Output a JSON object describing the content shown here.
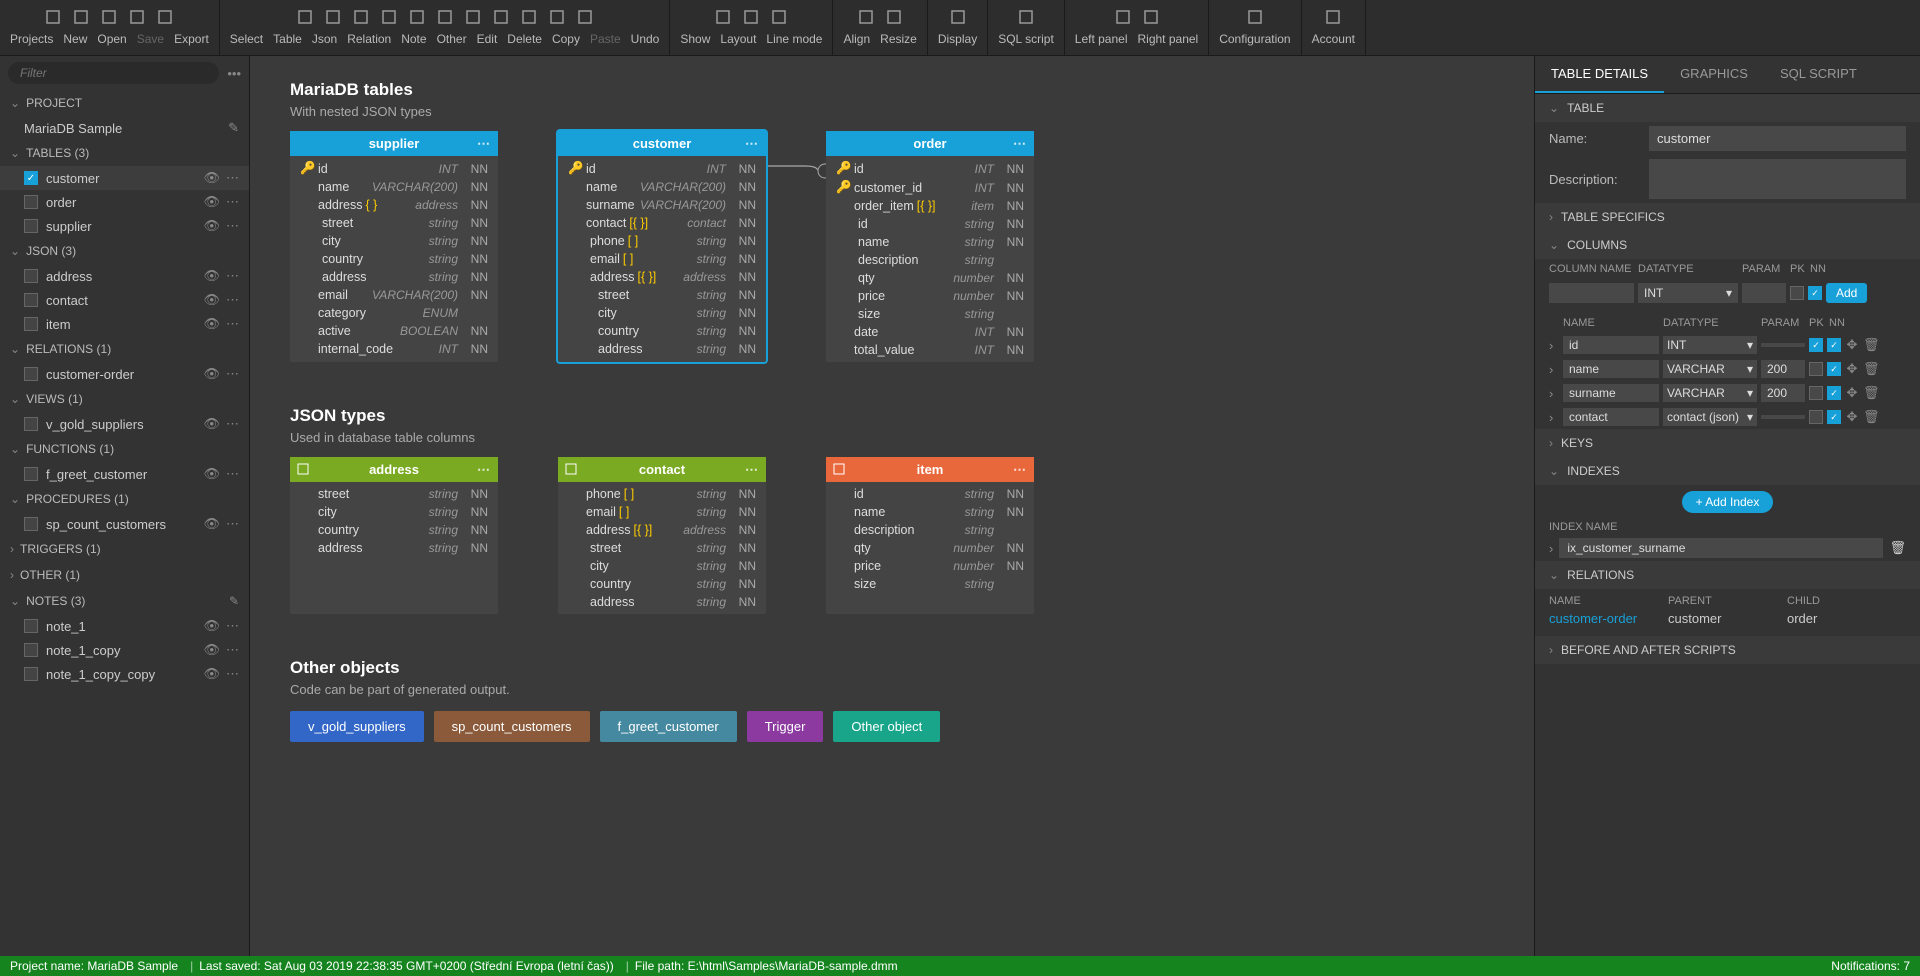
{
  "toolbar": {
    "groups": [
      {
        "labels": [
          "Projects",
          "New",
          "Open",
          "Save",
          "Export"
        ],
        "icons": [
          "folder-multiple",
          "file-new",
          "folder-open",
          "save",
          "export"
        ],
        "disabled": [
          3
        ]
      },
      {
        "labels": [
          "Select",
          "Table",
          "Json",
          "Relation",
          "Note",
          "Other",
          "Edit",
          "Delete",
          "Copy",
          "Paste",
          "Undo"
        ],
        "icons": [
          "cursor",
          "table",
          "json",
          "relation",
          "note",
          "other",
          "edit",
          "delete",
          "copy",
          "paste",
          "undo"
        ],
        "disabled": [
          9
        ]
      },
      {
        "labels": [
          "Show",
          "Layout",
          "Line mode"
        ],
        "icons": [
          "eye",
          "grid",
          "line"
        ]
      },
      {
        "labels": [
          "Align",
          "Resize"
        ],
        "icons": [
          "align",
          "resize"
        ]
      },
      {
        "labels": [
          "Display"
        ],
        "icons": [
          "display"
        ]
      },
      {
        "labels": [
          "SQL script"
        ],
        "icons": [
          "script"
        ]
      },
      {
        "labels": [
          "Left panel",
          "Right panel"
        ],
        "icons": [
          "left-panel",
          "right-panel"
        ],
        "bluedot": [
          0,
          1
        ]
      },
      {
        "labels": [
          "Configuration"
        ],
        "icons": [
          "gear"
        ]
      },
      {
        "labels": [
          "Account"
        ],
        "icons": [
          "user"
        ]
      }
    ]
  },
  "sidebar": {
    "filter_placeholder": "Filter",
    "sections": [
      {
        "title": "PROJECT",
        "items": [
          {
            "label": "MariaDB Sample",
            "edit": true
          }
        ]
      },
      {
        "title": "TABLES (3)",
        "items": [
          {
            "label": "customer",
            "checked": true,
            "active": true
          },
          {
            "label": "order"
          },
          {
            "label": "supplier"
          }
        ]
      },
      {
        "title": "JSON (3)",
        "items": [
          {
            "label": "address"
          },
          {
            "label": "contact"
          },
          {
            "label": "item"
          }
        ]
      },
      {
        "title": "RELATIONS (1)",
        "items": [
          {
            "label": "customer-order"
          }
        ]
      },
      {
        "title": "VIEWS (1)",
        "items": [
          {
            "label": "v_gold_suppliers"
          }
        ]
      },
      {
        "title": "FUNCTIONS (1)",
        "items": [
          {
            "label": "f_greet_customer"
          }
        ]
      },
      {
        "title": "PROCEDURES (1)",
        "items": [
          {
            "label": "sp_count_customers"
          }
        ]
      },
      {
        "title": "TRIGGERS (1)",
        "collapsed": true
      },
      {
        "title": "OTHER (1)",
        "collapsed": true
      },
      {
        "title": "NOTES (3)",
        "items": [
          {
            "label": "note_1"
          },
          {
            "label": "note_1_copy"
          },
          {
            "label": "note_1_copy_copy"
          }
        ]
      }
    ]
  },
  "canvas": {
    "section1": {
      "title": "MariaDB tables",
      "subtitle": "With nested JSON types"
    },
    "tables": {
      "supplier": {
        "name": "supplier",
        "rows": [
          {
            "pk": true,
            "name": "id",
            "type": "INT",
            "nn": "NN"
          },
          {
            "name": "name",
            "type": "VARCHAR(200)",
            "nn": "NN"
          },
          {
            "name": "address",
            "json": "{ }",
            "type": "address",
            "nn": "NN"
          },
          {
            "nested": 1,
            "name": "street",
            "type": "string",
            "nn": "NN"
          },
          {
            "nested": 1,
            "name": "city",
            "type": "string",
            "nn": "NN"
          },
          {
            "nested": 1,
            "name": "country",
            "type": "string",
            "nn": "NN"
          },
          {
            "nested": 1,
            "name": "address",
            "type": "string",
            "nn": "NN"
          },
          {
            "name": "email",
            "type": "VARCHAR(200)",
            "nn": "NN"
          },
          {
            "name": "category",
            "type": "ENUM",
            "nn": ""
          },
          {
            "name": "active",
            "type": "BOOLEAN",
            "nn": "NN"
          },
          {
            "name": "internal_code",
            "type": "INT",
            "nn": "NN"
          }
        ]
      },
      "customer": {
        "name": "customer",
        "rows": [
          {
            "pk": true,
            "name": "id",
            "type": "INT",
            "nn": "NN"
          },
          {
            "name": "name",
            "type": "VARCHAR(200)",
            "nn": "NN"
          },
          {
            "name": "surname",
            "type": "VARCHAR(200)",
            "nn": "NN"
          },
          {
            "name": "contact",
            "json": "[{ }]",
            "type": "contact",
            "nn": "NN"
          },
          {
            "nested": 1,
            "name": "phone",
            "json": "[ ]",
            "type": "string",
            "nn": "NN"
          },
          {
            "nested": 1,
            "name": "email",
            "json": "[ ]",
            "type": "string",
            "nn": "NN"
          },
          {
            "nested": 1,
            "name": "address",
            "json": "[{ }]",
            "type": "address",
            "nn": "NN"
          },
          {
            "nested": 2,
            "name": "street",
            "type": "string",
            "nn": "NN"
          },
          {
            "nested": 2,
            "name": "city",
            "type": "string",
            "nn": "NN"
          },
          {
            "nested": 2,
            "name": "country",
            "type": "string",
            "nn": "NN"
          },
          {
            "nested": 2,
            "name": "address",
            "type": "string",
            "nn": "NN"
          }
        ]
      },
      "order": {
        "name": "order",
        "rows": [
          {
            "pk": true,
            "name": "id",
            "type": "INT",
            "nn": "NN"
          },
          {
            "fk": true,
            "name": "customer_id",
            "type": "INT",
            "nn": "NN"
          },
          {
            "name": "order_item",
            "json": "[{ }]",
            "type": "item",
            "nn": "NN"
          },
          {
            "nested": 1,
            "name": "id",
            "type": "string",
            "nn": "NN"
          },
          {
            "nested": 1,
            "name": "name",
            "type": "string",
            "nn": "NN"
          },
          {
            "nested": 1,
            "name": "description",
            "type": "string",
            "nn": ""
          },
          {
            "nested": 1,
            "name": "qty",
            "type": "number",
            "nn": "NN"
          },
          {
            "nested": 1,
            "name": "price",
            "type": "number",
            "nn": "NN"
          },
          {
            "nested": 1,
            "name": "size",
            "type": "string",
            "nn": ""
          },
          {
            "name": "date",
            "type": "INT",
            "nn": "NN"
          },
          {
            "name": "total_value",
            "type": "INT",
            "nn": "NN"
          }
        ]
      }
    },
    "section2": {
      "title": "JSON types",
      "subtitle": "Used in database table columns"
    },
    "json": {
      "address": {
        "name": "address",
        "rows": [
          {
            "name": "street",
            "type": "string",
            "nn": "NN"
          },
          {
            "name": "city",
            "type": "string",
            "nn": "NN"
          },
          {
            "name": "country",
            "type": "string",
            "nn": "NN"
          },
          {
            "name": "address",
            "type": "string",
            "nn": "NN"
          }
        ]
      },
      "contact": {
        "name": "contact",
        "rows": [
          {
            "name": "phone",
            "json": "[ ]",
            "type": "string",
            "nn": "NN"
          },
          {
            "name": "email",
            "json": "[ ]",
            "type": "string",
            "nn": "NN"
          },
          {
            "name": "address",
            "json": "[{ }]",
            "type": "address",
            "nn": "NN"
          },
          {
            "nested": 1,
            "name": "street",
            "type": "string",
            "nn": "NN"
          },
          {
            "nested": 1,
            "name": "city",
            "type": "string",
            "nn": "NN"
          },
          {
            "nested": 1,
            "name": "country",
            "type": "string",
            "nn": "NN"
          },
          {
            "nested": 1,
            "name": "address",
            "type": "string",
            "nn": "NN"
          }
        ]
      },
      "item": {
        "name": "item",
        "rows": [
          {
            "name": "id",
            "type": "string",
            "nn": "NN"
          },
          {
            "name": "name",
            "type": "string",
            "nn": "NN"
          },
          {
            "name": "description",
            "type": "string",
            "nn": ""
          },
          {
            "name": "qty",
            "type": "number",
            "nn": "NN"
          },
          {
            "name": "price",
            "type": "number",
            "nn": "NN"
          },
          {
            "name": "size",
            "type": "string",
            "nn": ""
          }
        ]
      }
    },
    "section3": {
      "title": "Other objects",
      "subtitle": "Code can be part of generated output."
    },
    "other_objects": [
      {
        "label": "v_gold_suppliers",
        "cls": "blue"
      },
      {
        "label": "sp_count_customers",
        "cls": "brown"
      },
      {
        "label": "f_greet_customer",
        "cls": "teal"
      },
      {
        "label": "Trigger",
        "cls": "purple"
      },
      {
        "label": "Other object",
        "cls": "green"
      }
    ]
  },
  "right": {
    "tabs": [
      "TABLE DETAILS",
      "GRAPHICS",
      "SQL SCRIPT"
    ],
    "active_tab": 0,
    "table_section": "TABLE",
    "name_label": "Name:",
    "name_value": "customer",
    "desc_label": "Description:",
    "sections": {
      "specifics": "TABLE SPECIFICS",
      "columns": "COLUMNS",
      "keys": "KEYS",
      "indexes": "INDEXES",
      "relations": "RELATIONS",
      "scripts": "BEFORE AND AFTER SCRIPTS"
    },
    "col_hdrs": {
      "name": "COLUMN NAME",
      "datatype": "DATATYPE",
      "param": "PARAM",
      "pk": "PK",
      "nn": "NN"
    },
    "col_list_hdrs": {
      "name": "NAME",
      "datatype": "DATATYPE",
      "param": "PARAM",
      "pk": "PK",
      "nn": "NN"
    },
    "add_dt": "INT",
    "add_btn": "Add",
    "columns": [
      {
        "name": "id",
        "dt": "INT",
        "param": "",
        "pk": true,
        "nn": true
      },
      {
        "name": "name",
        "dt": "VARCHAR",
        "param": "200",
        "pk": false,
        "nn": true
      },
      {
        "name": "surname",
        "dt": "VARCHAR",
        "param": "200",
        "pk": false,
        "nn": true
      },
      {
        "name": "contact",
        "dt": "contact (json)",
        "param": "",
        "pk": false,
        "nn": true
      }
    ],
    "add_index_btn": "+ Add Index",
    "index_hdr": "INDEX NAME",
    "indexes": [
      "ix_customer_surname"
    ],
    "rel_hdrs": {
      "name": "NAME",
      "parent": "PARENT",
      "child": "CHILD"
    },
    "relations": [
      {
        "name": "customer-order",
        "parent": "customer",
        "child": "order"
      }
    ]
  },
  "status": {
    "project": "Project name: MariaDB Sample",
    "saved": "Last saved: Sat Aug 03 2019 22:38:35 GMT+0200 (Střední Evropa (letní čas))",
    "path": "File path: E:\\html\\Samples\\MariaDB-sample.dmm",
    "notifications": "Notifications: 7"
  }
}
